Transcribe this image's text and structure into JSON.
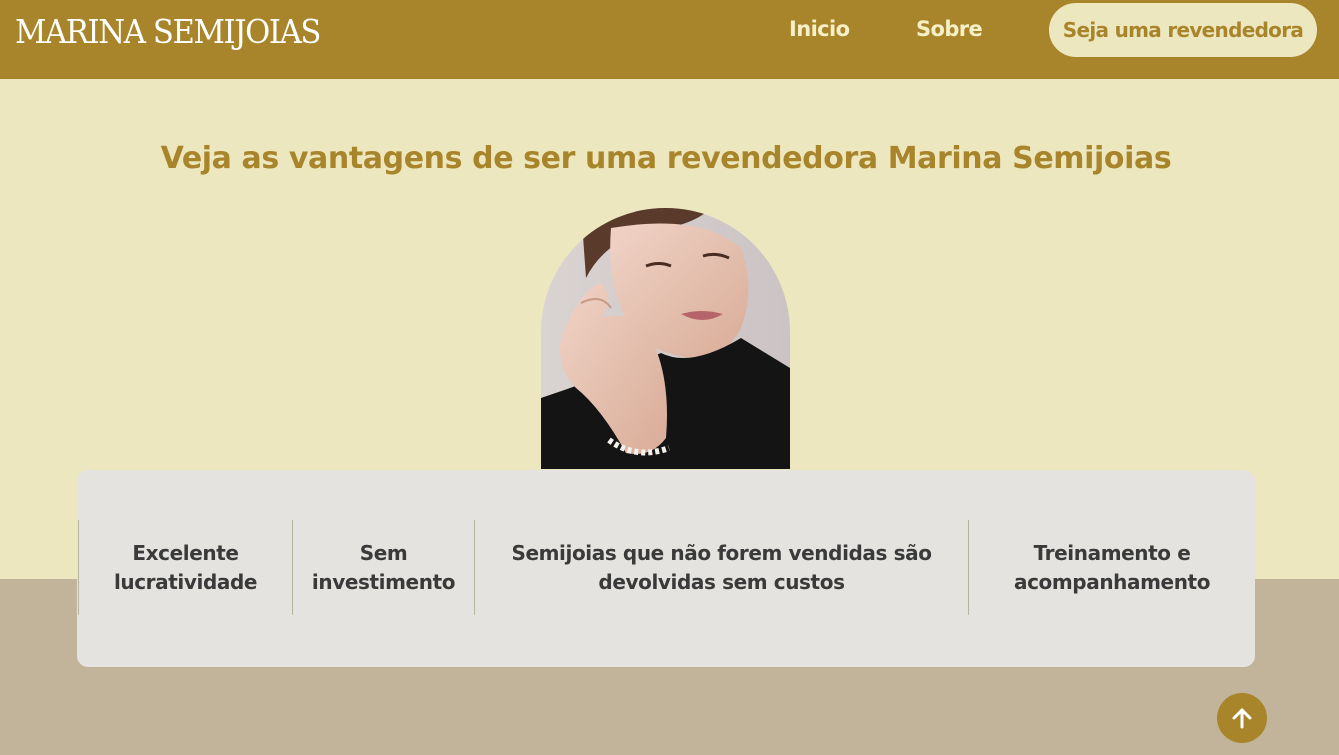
{
  "header": {
    "brand": "MARINA SEMIJOIAS",
    "nav": {
      "inicio": "Inicio",
      "sobre": "Sobre",
      "cta": "Seja uma revendedora"
    }
  },
  "main": {
    "headline": "Veja as vantagens de ser uma revendedora Marina Semijoias",
    "features": [
      {
        "line1": "Excelente",
        "line2": "lucratividade"
      },
      {
        "line1": "Sem",
        "line2": "investimento"
      },
      {
        "line1": "Semijoias que não forem vendidas são",
        "line2": "devolvidas sem custos"
      },
      {
        "line1": "Treinamento e",
        "line2": "acompanhamento"
      }
    ]
  },
  "icons": {
    "scroll_top": "arrow-up-icon"
  },
  "colors": {
    "brand_gold": "#a8852a",
    "cream": "#ede7bf",
    "card_gray": "#e4e3df",
    "taupe": "#c1b49a"
  }
}
